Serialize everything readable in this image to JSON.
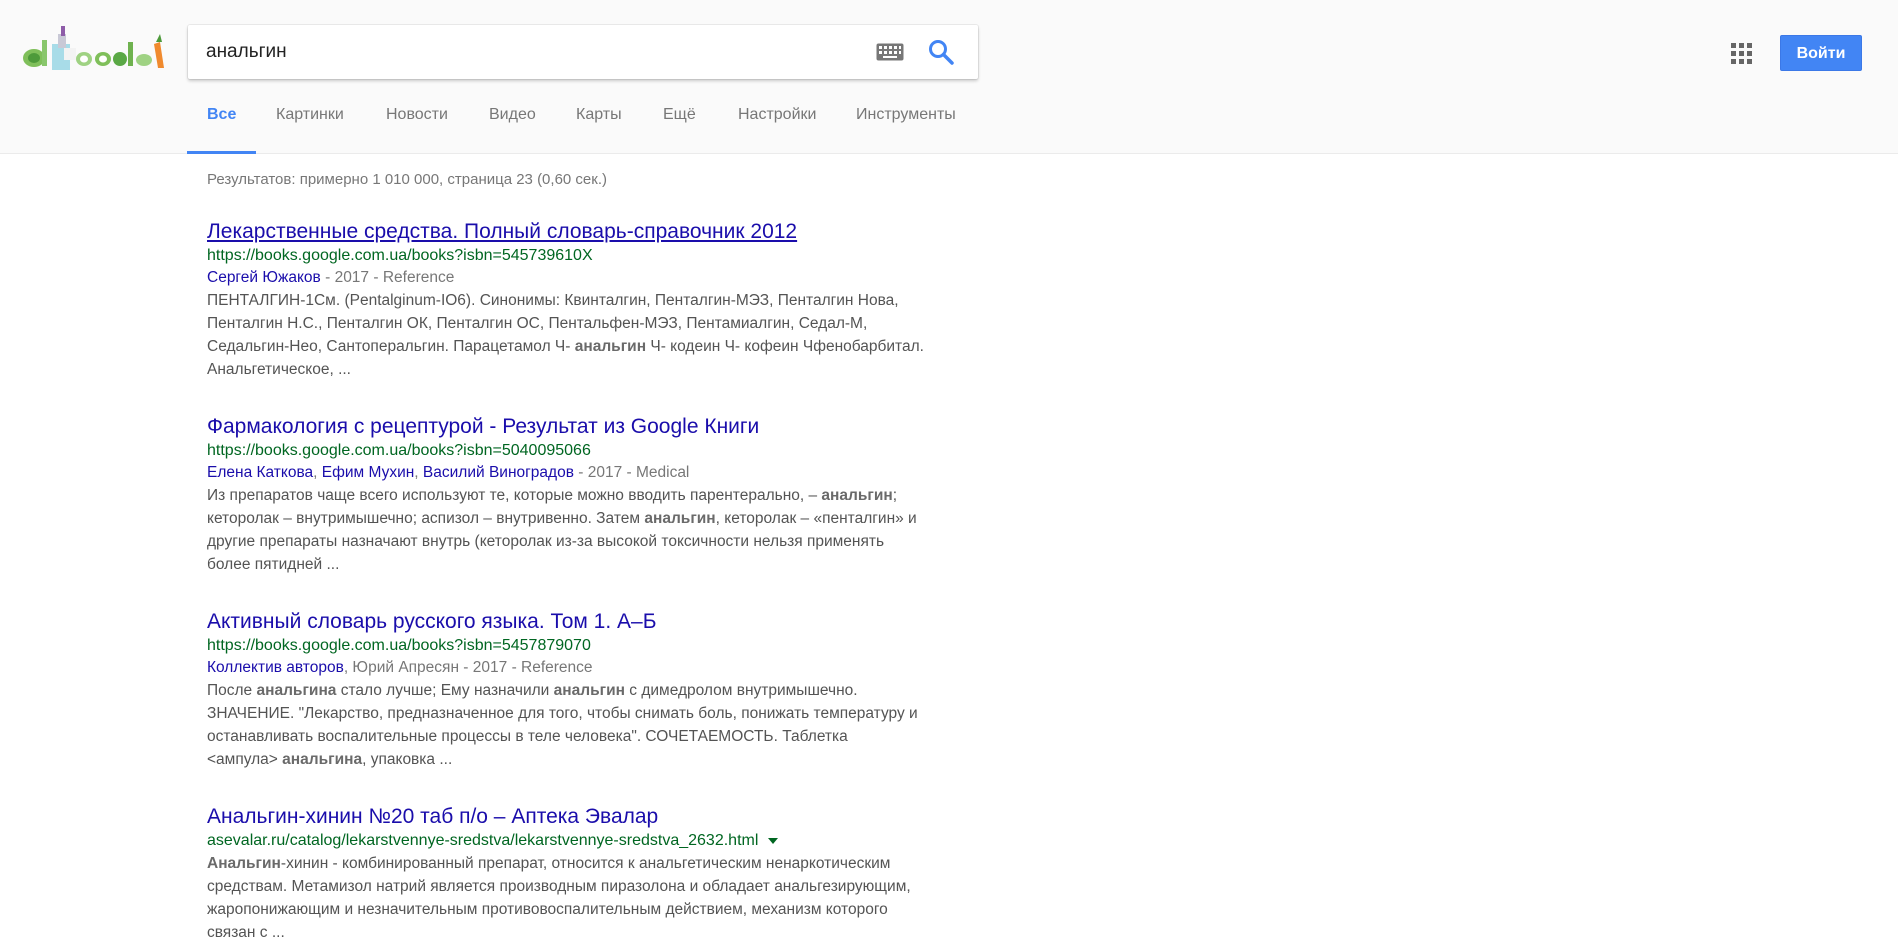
{
  "search": {
    "query": "анальгин",
    "placeholder": ""
  },
  "header": {
    "signin_label": "Войти"
  },
  "icons": {
    "logo": "doodle-logo",
    "keyboard": "keyboard-icon",
    "search": "search-icon",
    "apps": "apps-grid-icon"
  },
  "colors": {
    "accent": "#4285f4",
    "link": "#1a0dab",
    "url": "#006621",
    "snippet": "#545454"
  },
  "tabs": [
    {
      "label": "Все",
      "active": true
    },
    {
      "label": "Картинки"
    },
    {
      "label": "Новости"
    },
    {
      "label": "Видео"
    },
    {
      "label": "Карты"
    },
    {
      "label": "Ещё"
    },
    {
      "label": "Настройки"
    },
    {
      "label": "Инструменты"
    }
  ],
  "results_stats": "Результатов: примерно 1 010 000, страница 23 (0,60 сек.)",
  "results": [
    {
      "title": "Лекарственные средства. Полный словарь-справочник 2012",
      "url": "https://books.google.com.ua/books?isbn=545739610X",
      "authors": [
        "Сергей Южаков"
      ],
      "meta_tail": " - 2017 - Reference",
      "snippet_lines": [
        [
          {
            "t": "ПЕНТАЛГИН-1См. (Pentalginum-IO6). Синонимы: Квинталгин, Пенталгин-МЭЗ, Пенталгин Нова,"
          }
        ],
        [
          {
            "t": "Пенталгин Н.С., Пенталгин ОК, Пенталгин ОС, Пентальфен-МЭЗ, Пентамиалгин, Седал-М,"
          }
        ],
        [
          {
            "t": "Седальгин-Нео, Сантоперальгин. Парацетамол Ч- "
          },
          {
            "t": "анальгин",
            "b": true
          },
          {
            "t": " Ч- кодеин Ч- кофеин Чфенобарбитал."
          }
        ],
        [
          {
            "t": "Анальгетическое, ..."
          }
        ]
      ]
    },
    {
      "title": "Фармакология с рецептурой - Результат из Google Книги",
      "url": "https://books.google.com.ua/books?isbn=5040095066",
      "authors": [
        "Елена Каткова",
        "Ефим Мухин",
        "Василий Виноградов"
      ],
      "meta_tail": " - 2017 - Medical",
      "snippet_lines": [
        [
          {
            "t": "Из препаратов чаще всего используют те, которые можно вводить парентерально, – "
          },
          {
            "t": "анальгин",
            "b": true
          },
          {
            "t": ";"
          }
        ],
        [
          {
            "t": "кеторолак – внутримышечно; аспизол – внутривенно. Затем "
          },
          {
            "t": "анальгин",
            "b": true
          },
          {
            "t": ", кеторолак – «пенталгин» и"
          }
        ],
        [
          {
            "t": "другие препараты назначают внутрь (кеторолак из-за высокой токсичности нельзя применять"
          }
        ],
        [
          {
            "t": "более пятидней ..."
          }
        ]
      ]
    },
    {
      "title": "Активный словарь русского языка. Том 1. А–Б",
      "url": "https://books.google.com.ua/books?isbn=5457879070",
      "authors": [
        "Коллектив авторов"
      ],
      "meta_tail": ", Юрий Апресян - 2017 - Reference",
      "snippet_lines": [
        [
          {
            "t": "После "
          },
          {
            "t": "анальгина",
            "b": true
          },
          {
            "t": " стало лучше; Ему назначили "
          },
          {
            "t": "анальгин",
            "b": true
          },
          {
            "t": " с димедролом внутримышечно."
          }
        ],
        [
          {
            "t": "ЗНАЧЕНИЕ. \"Лекарство, предназначенное для того, чтобы снимать боль, понижать температуру и"
          }
        ],
        [
          {
            "t": "останавливать воспалительные процессы в теле человека\". СОЧЕТАЕМОСТЬ. Таблетка"
          }
        ],
        [
          {
            "t": "<ампула> "
          },
          {
            "t": "анальгина",
            "b": true
          },
          {
            "t": ", упаковка ..."
          }
        ]
      ]
    },
    {
      "title": "Анальгин-хинин №20 таб п/о – Аптека Эвалар",
      "url": "asevalar.ru/catalog/lekarstvennye-sredstva/lekarstvennye-sredstva_2632.html",
      "has_dropdown": true,
      "authors": [],
      "meta_tail": "",
      "snippet_lines": [
        [
          {
            "t": "Анальгин",
            "b": true
          },
          {
            "t": "-хинин - комбинированный препарат, относится к анальгетическим ненаркотическим"
          }
        ],
        [
          {
            "t": "средствам. Метамизол натрий является производным пиразолона и обладает анальгезирующим,"
          }
        ],
        [
          {
            "t": "жаропонижающим и незначительным противовоспалительным действием, механизм которого"
          }
        ],
        [
          {
            "t": "связан с ..."
          }
        ]
      ]
    }
  ]
}
